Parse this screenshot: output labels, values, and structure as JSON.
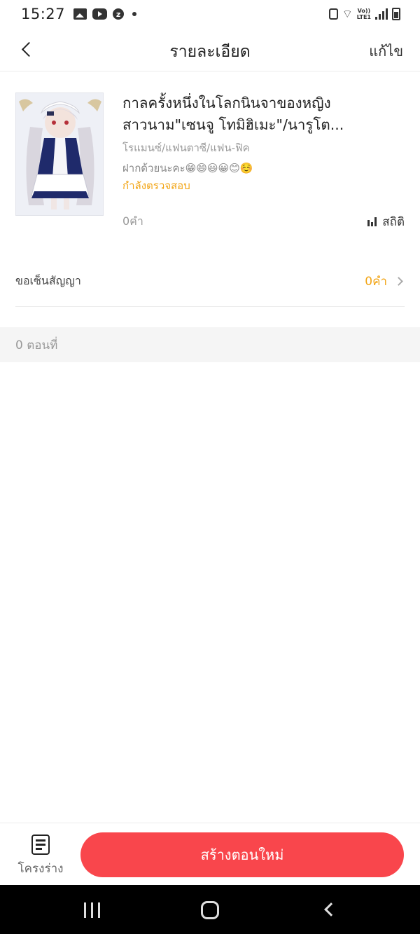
{
  "status_bar": {
    "time": "15:27",
    "left_icons": [
      "gallery-icon",
      "youtube-icon",
      "z-app-icon",
      "notification-dot"
    ],
    "right_icons": [
      "lock-icon",
      "wifi-icon",
      "volte-icon",
      "signal-icon",
      "battery-icon"
    ],
    "lte_label_top": "Vo))",
    "lte_label_bottom": "LTE1"
  },
  "header": {
    "title": "รายละเอียด",
    "edit_label": "แก้ไข"
  },
  "novel": {
    "title_line1": "กาลครั้งหนึ่งในโลกนินจาของหญิง",
    "title_line2": "สาวนาม\"เซนจู โทมิฮิเมะ\"/นารูโต...",
    "genre": "โรแมนซ์/แฟนตาซี/แฟน-ฟิค",
    "note": "ฝากด้วยนะคะ😁😄😃😀😊☺️",
    "status": "กำลังตรวจสอบ",
    "word_count": "0คำ",
    "stats_label": "สถิติ",
    "accent_color": "#f2a516"
  },
  "contract": {
    "label": "ขอเซ็นสัญญา",
    "value": "0คำ"
  },
  "episodes": {
    "count_label": "0 ตอนที่"
  },
  "bottom": {
    "draft_label": "โครงร่าง",
    "create_label": "สร้างตอนใหม่",
    "create_color": "#f9464c"
  },
  "nav": {
    "buttons": [
      "recent-apps",
      "home",
      "back"
    ]
  }
}
